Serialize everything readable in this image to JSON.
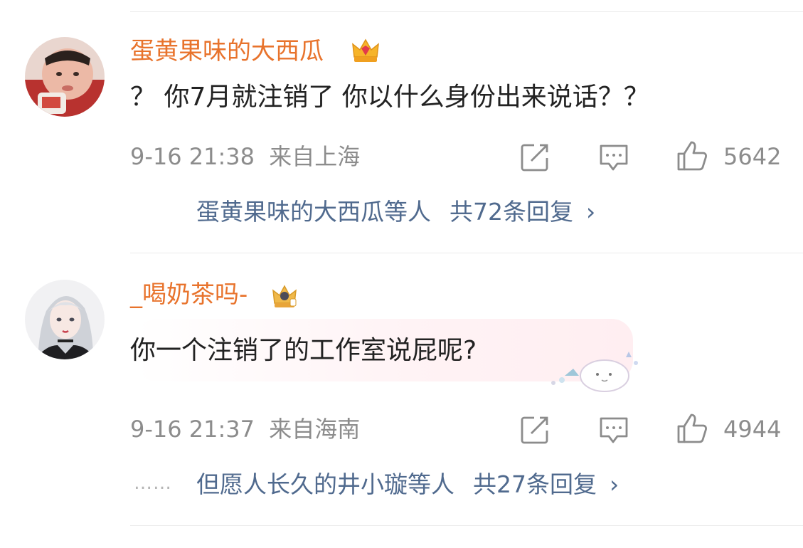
{
  "comments": [
    {
      "username": "蛋黄果味的大西瓜",
      "text": "？ 你7月就注销了 你以什么身份出来说话？？",
      "date": "9-16 21:38",
      "location": "来自上海",
      "likes": "5642",
      "replies_from": "蛋黄果味的大西瓜等人",
      "replies_count": "共72条回复",
      "badge_icon": "crown-icon",
      "avatar_icon": "child-avatar"
    },
    {
      "username": "_喝奶茶吗-",
      "text": "你一个注销了的工作室说屁呢?",
      "date": "9-16 21:37",
      "location": "来自海南",
      "likes": "4944",
      "replies_from": "但愿人长久的井小璇等人",
      "replies_count": "共27条回复",
      "badge_icon": "crown-icon",
      "avatar_icon": "anime-girl-avatar",
      "ellipsis": "……"
    }
  ],
  "chevron": "›",
  "colors": {
    "username": "#e8732c",
    "reply_link": "#506a8e",
    "meta": "#8c8c8c",
    "text": "#222222"
  }
}
